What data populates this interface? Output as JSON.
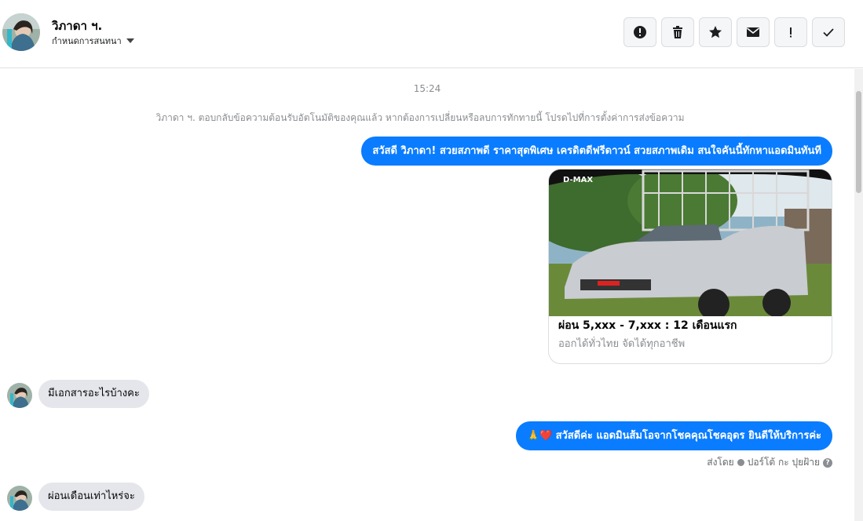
{
  "header": {
    "name": "วิภาดา ฯ.",
    "assign_label": "กำหนดการสนทนา"
  },
  "toolbar": {
    "buttons": [
      {
        "icon": "alert-circle-icon"
      },
      {
        "icon": "trash-icon"
      },
      {
        "icon": "star-icon"
      },
      {
        "icon": "envelope-icon"
      },
      {
        "icon": "exclamation-icon"
      },
      {
        "icon": "checkmark-icon"
      }
    ]
  },
  "conversation": {
    "timestamp": "15:24",
    "system_note": "วิภาดา ฯ. ตอบกลับข้อความต้อนรับอัตโนมัติของคุณแล้ว หากต้องการเปลี่ยนหรือลบการทักทายนี้ โปรดไปที่การตั้งค่าการส่งข้อความ",
    "messages": [
      {
        "from": "page",
        "text": "สวัสดี วิภาดา! สวยสภาพดี ราคาสุดพิเศษ เครดิตดีฟรีดาวน์ สวยสภาพเดิม สนใจคันนี้ทักหาแอดมินทันที"
      },
      {
        "from": "page",
        "type": "card",
        "title": "ผ่อน 5,xxx - 7,xxx : 12 เดือนแรก",
        "subtitle": "ออกได้ทั่วไทย จัดได้ทุกอาชีพ",
        "image_banner": "D-MAX"
      },
      {
        "from": "customer",
        "text": "มีเอกสารอะไรบ้างคะ"
      },
      {
        "from": "page",
        "emoji": "🙏❤️",
        "text": "สวัสดีค่ะ แอดมินส้มโอจากโชคคุณโชคอุดร ยินดีให้บริการค่ะ"
      },
      {
        "from": "customer",
        "text": "ผ่อนเดือนเท่าไหร่จะ"
      }
    ],
    "sent_by_label": "ส่งโดย",
    "sent_by_name": "ปอร์โต้ กะ ปุยฝ้าย"
  },
  "colors": {
    "outgoing_bubble": "#0a7cff",
    "incoming_bubble": "#e4e6eb",
    "meta_text": "#8a8d91"
  }
}
